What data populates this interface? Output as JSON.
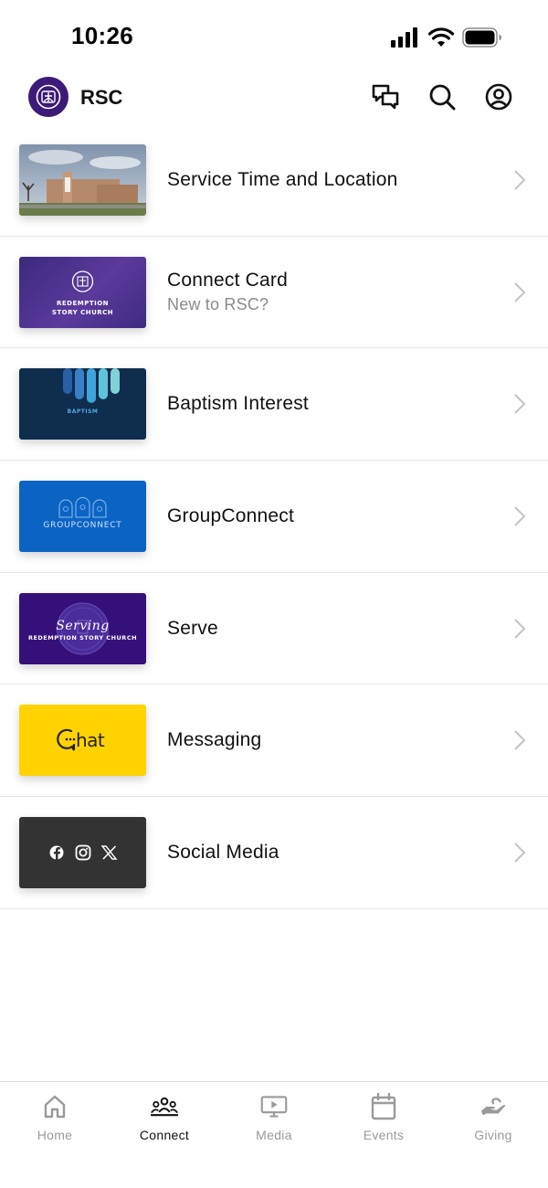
{
  "status_bar": {
    "time": "10:26"
  },
  "header": {
    "title": "RSC",
    "actions": [
      {
        "name": "messages-button",
        "icon": "chat-bubbles-icon"
      },
      {
        "name": "search-button",
        "icon": "search-icon"
      },
      {
        "name": "profile-button",
        "icon": "user-circle-icon"
      }
    ]
  },
  "items": [
    {
      "title": "Service Time and Location",
      "subtitle": "",
      "thumb": "church-building-photo"
    },
    {
      "title": "Connect Card",
      "subtitle": "New to RSC?",
      "thumb": "redemption-story-church-card",
      "thumb_text": "REDEMPTION STORY CHURCH"
    },
    {
      "title": "Baptism Interest",
      "subtitle": "",
      "thumb": "baptism-graphic",
      "thumb_text": "BAPTISM"
    },
    {
      "title": "GroupConnect",
      "subtitle": "",
      "thumb": "groupconnect-graphic",
      "thumb_text": "GROUPCONNECT"
    },
    {
      "title": "Serve",
      "subtitle": "",
      "thumb": "serving-graphic",
      "thumb_script": "Serving",
      "thumb_text": "REDEMPTION STORY CHURCH"
    },
    {
      "title": "Messaging",
      "subtitle": "",
      "thumb": "chat-graphic",
      "thumb_text": "hat"
    },
    {
      "title": "Social Media",
      "subtitle": "",
      "thumb": "social-icons-graphic"
    }
  ],
  "tabs": [
    {
      "label": "Home",
      "icon": "house-icon",
      "active": false
    },
    {
      "label": "Connect",
      "icon": "people-group-icon",
      "active": true
    },
    {
      "label": "Media",
      "icon": "monitor-play-icon",
      "active": false
    },
    {
      "label": "Events",
      "icon": "calendar-icon",
      "active": false
    },
    {
      "label": "Giving",
      "icon": "giving-hand-icon",
      "active": false
    }
  ],
  "colors": {
    "brand_purple": "#3c1a78",
    "tab_inactive": "#9a9a9a",
    "tab_active": "#111111",
    "messaging_yellow": "#ffd200",
    "groupconnect_blue": "#0b63c4",
    "baptism_navy": "#0f2d4d",
    "social_dark": "#333333"
  }
}
